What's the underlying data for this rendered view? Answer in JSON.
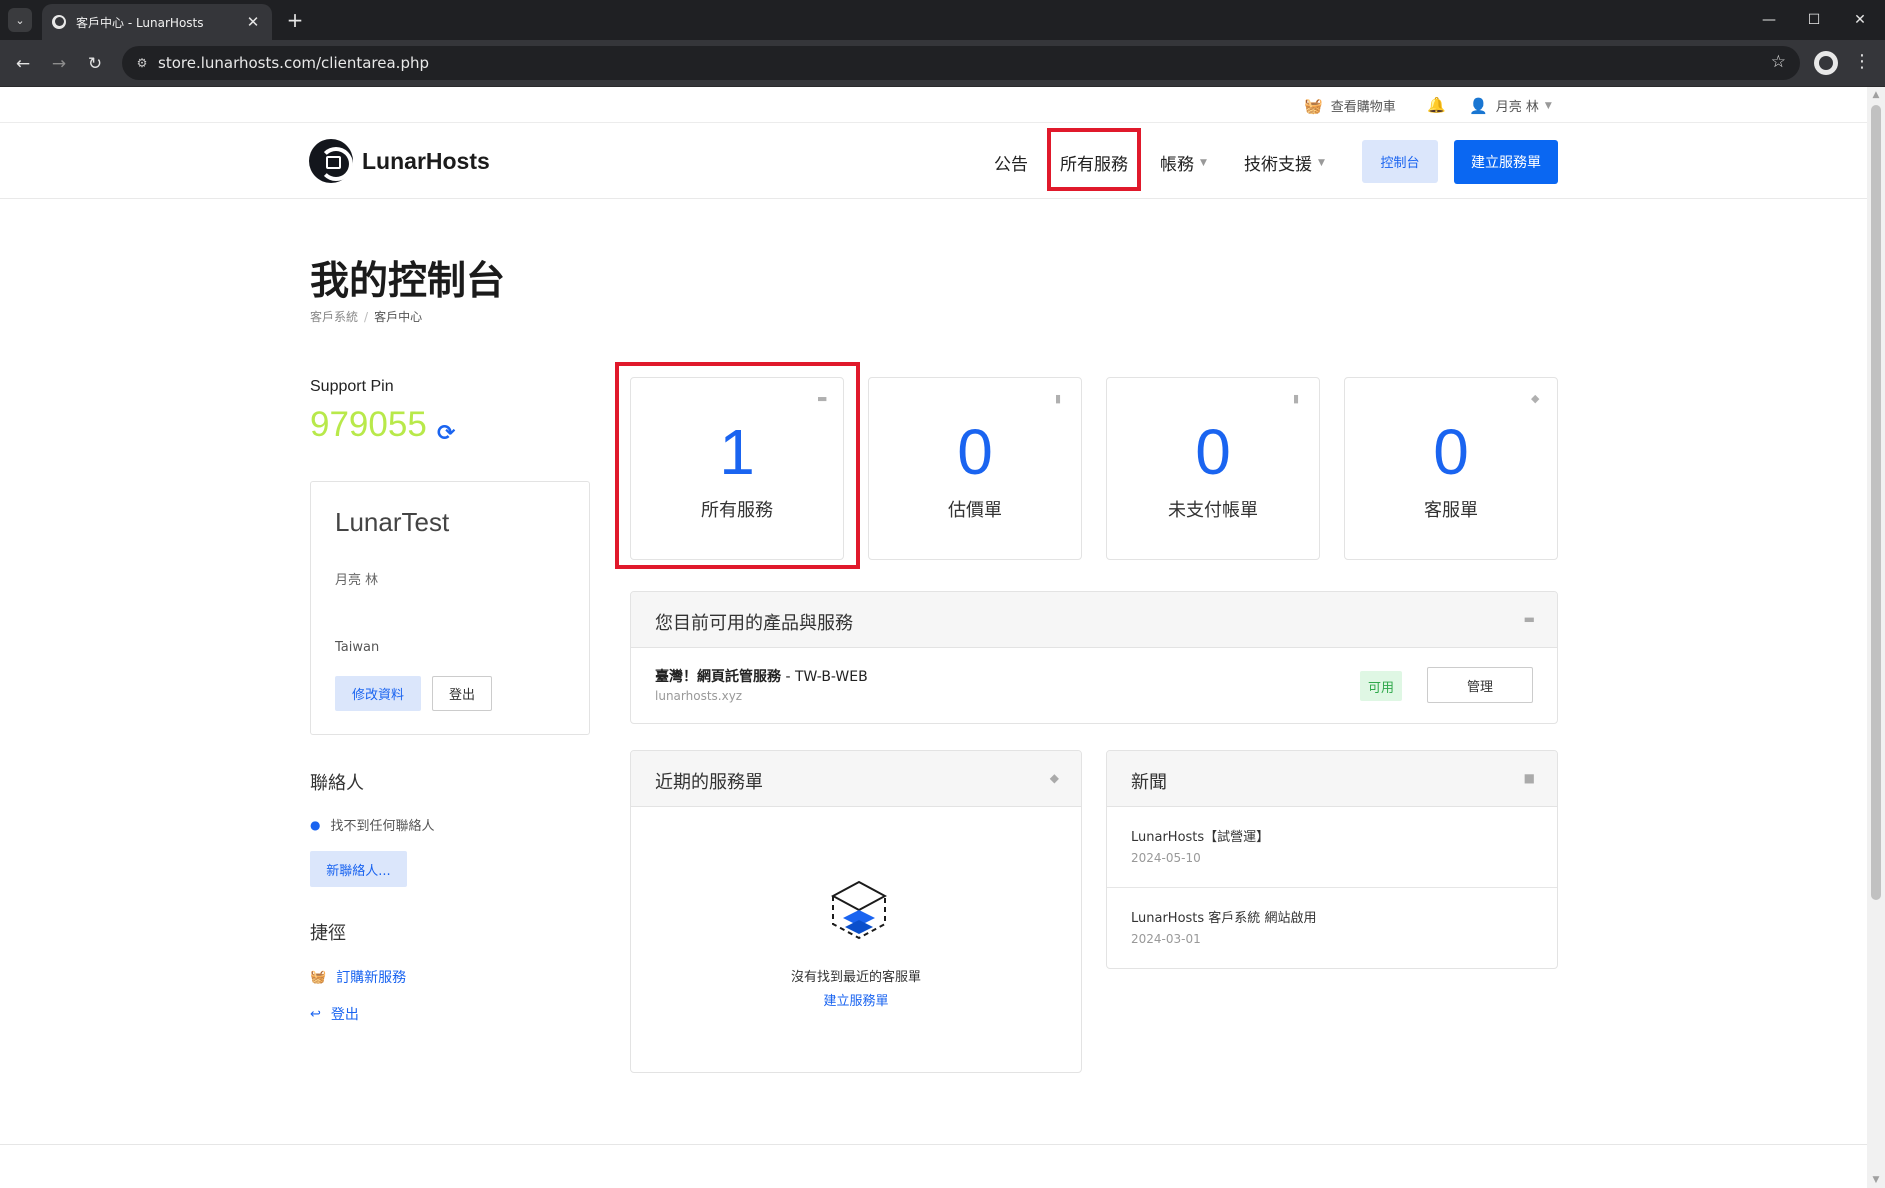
{
  "browser": {
    "tab_title": "客戶中心 - LunarHosts",
    "url": "store.lunarhosts.com/clientarea.php"
  },
  "topbar": {
    "cart_label": "查看購物車",
    "user_name": "月亮 林"
  },
  "header": {
    "logo_text": "LunarHosts",
    "nav": {
      "announcements": "公告",
      "services": "所有服務",
      "billing": "帳務",
      "support": "技術支援"
    },
    "dashboard_button": "控制台",
    "new_ticket_button": "建立服務單"
  },
  "page": {
    "title": "我的控制台",
    "breadcrumb": [
      "客戶系統",
      "客戶中心"
    ]
  },
  "sidebar": {
    "support_pin_label": "Support Pin",
    "support_pin": "979055",
    "profile": {
      "company": "LunarTest",
      "name": "月亮 林",
      "country": "Taiwan",
      "edit_button": "修改資料",
      "logout_button": "登出"
    },
    "contacts": {
      "heading": "聯絡人",
      "empty_text": "找不到任何聯絡人",
      "new_button": "新聯絡人..."
    },
    "shortcuts": {
      "heading": "捷徑",
      "items": [
        "訂購新服務",
        "登出"
      ]
    }
  },
  "stats": [
    {
      "value": "1",
      "label": "所有服務",
      "icon": "server-icon"
    },
    {
      "value": "0",
      "label": "估價單",
      "icon": "document-icon"
    },
    {
      "value": "0",
      "label": "未支付帳單",
      "icon": "document-icon"
    },
    {
      "value": "0",
      "label": "客服單",
      "icon": "tag-icon"
    }
  ],
  "services_panel": {
    "title": "您目前可用的產品與服務",
    "item": {
      "product": "臺灣！網頁託管服務",
      "plan": " - TW-B-WEB",
      "domain": "lunarhosts.xyz",
      "status": "可用",
      "manage_button": "管理"
    }
  },
  "tickets_panel": {
    "title": "近期的服務單",
    "empty_text": "沒有找到最近的客服單",
    "create_link": "建立服務單"
  },
  "news_panel": {
    "title": "新聞",
    "items": [
      {
        "title": "LunarHosts【試營運】",
        "date": "2024-05-10"
      },
      {
        "title": "LunarHosts 客戶系統 網站啟用",
        "date": "2024-03-01"
      }
    ]
  },
  "colors": {
    "accent": "#1a64f0",
    "pin": "#b8e94a",
    "highlight": "#e0192b",
    "status_ok": "#2ea84a"
  }
}
